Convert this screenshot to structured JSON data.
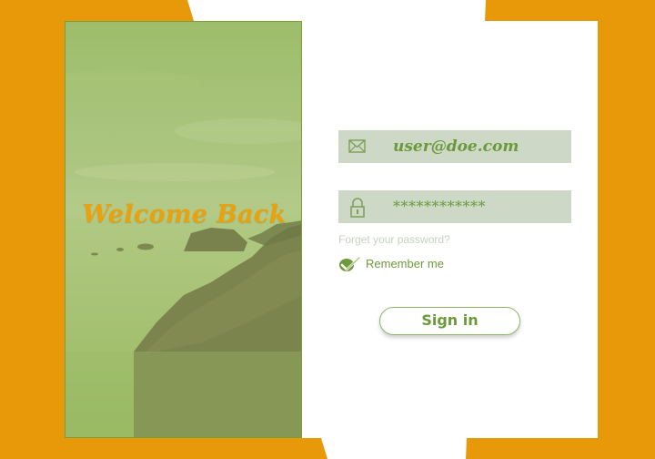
{
  "colors": {
    "background": "#e8990a",
    "accent_green": "#6b9a3b",
    "field_background": "#cdd8c6",
    "title_gold": "#e8a20f"
  },
  "hero": {
    "title": "Welcome Back"
  },
  "login_form": {
    "email": {
      "icon": "mail-icon",
      "value": "user@doe.com"
    },
    "password": {
      "icon": "lock-icon",
      "value": "************"
    },
    "forgot_password_link": "Forget your password?",
    "remember_me": {
      "icon": "checkmark-icon",
      "label": "Remember me",
      "checked": true
    },
    "sign_in_button": "Sign in"
  }
}
